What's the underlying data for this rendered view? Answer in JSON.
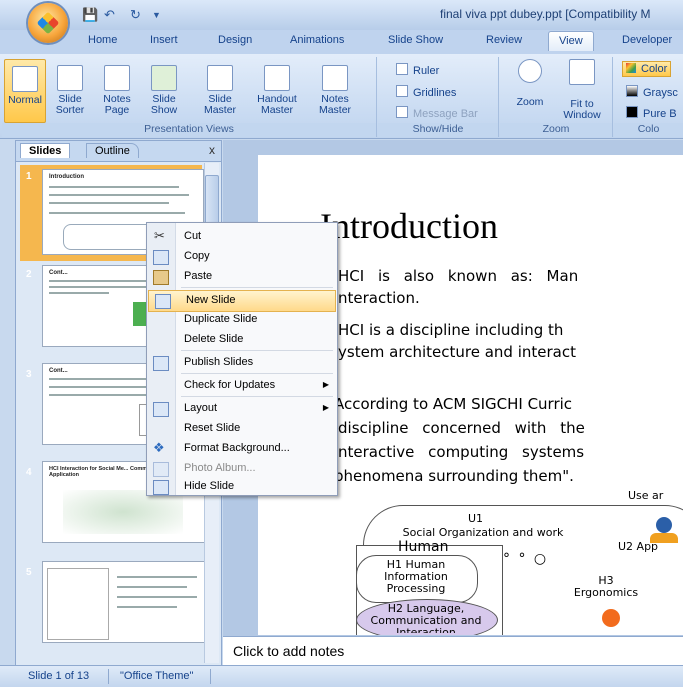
{
  "title_bar": {
    "title": "final viva ppt dubey.ppt [Compatibility M"
  },
  "tabs": [
    "Home",
    "Insert",
    "Design",
    "Animations",
    "Slide Show",
    "Review",
    "View",
    "Developer"
  ],
  "active_tab": "View",
  "ribbon": {
    "presentation_views": {
      "label": "Presentation Views",
      "buttons": [
        {
          "line1": "Normal",
          "line2": ""
        },
        {
          "line1": "Slide",
          "line2": "Sorter"
        },
        {
          "line1": "Notes",
          "line2": "Page"
        },
        {
          "line1": "Slide",
          "line2": "Show"
        },
        {
          "line1": "Slide",
          "line2": "Master"
        },
        {
          "line1": "Handout",
          "line2": "Master"
        },
        {
          "line1": "Notes",
          "line2": "Master"
        }
      ]
    },
    "show_hide": {
      "label": "Show/Hide",
      "items": [
        "Ruler",
        "Gridlines",
        "Message Bar"
      ]
    },
    "zoom": {
      "label": "Zoom",
      "buttons": [
        {
          "line1": "Zoom",
          "line2": ""
        },
        {
          "line1": "Fit to",
          "line2": "Window"
        }
      ]
    },
    "color": {
      "label": "Colo",
      "items": [
        "Color",
        "Graysc",
        "Pure B"
      ]
    }
  },
  "left_pane": {
    "tabs": [
      "Slides",
      "Outline"
    ],
    "close": "x",
    "slides": [
      {
        "num": "1",
        "title": "Introduction"
      },
      {
        "num": "2",
        "title": "Cont..."
      },
      {
        "num": "3",
        "title": "Cont..."
      },
      {
        "num": "4",
        "title": "HCI Interaction for Social Me... Communication & Application"
      },
      {
        "num": "5",
        "title": ""
      }
    ]
  },
  "slide": {
    "title": "Introduction",
    "lines": [
      "HCI is also known as: Man",
      "nteraction.",
      "HCI is a discipline including th",
      "ystem architecture and interact",
      "According to ACM SIGCHI Curric",
      "discipline concerned with the",
      "nteractive computing systems",
      "phenomena surrounding them\"."
    ],
    "diagram": {
      "use_label": "Use ar",
      "u1": "U1",
      "u1_sub": "Social Organization and work",
      "human": "Human",
      "u2": "U2 App",
      "h1": "H1 Human Information Processing",
      "h2": "H2 Language, Communication and Interaction",
      "h3": "H3 Ergonomics"
    }
  },
  "notes_placeholder": "Click to add notes",
  "context_menu": [
    {
      "label": "Cut",
      "icon": "scissors-icon",
      "type": "item"
    },
    {
      "label": "Copy",
      "icon": "copy-icon",
      "type": "item"
    },
    {
      "label": "Paste",
      "icon": "paste-icon",
      "type": "item"
    },
    {
      "type": "sep"
    },
    {
      "label": "New Slide",
      "icon": "new-slide-icon",
      "type": "item",
      "hot": true
    },
    {
      "label": "Duplicate Slide",
      "icon": "",
      "type": "item"
    },
    {
      "label": "Delete Slide",
      "icon": "",
      "type": "item"
    },
    {
      "type": "sep"
    },
    {
      "label": "Publish Slides",
      "icon": "publish-icon",
      "type": "item"
    },
    {
      "type": "sep"
    },
    {
      "label": "Check for Updates",
      "icon": "",
      "type": "item",
      "submenu": true
    },
    {
      "type": "sep"
    },
    {
      "label": "Layout",
      "icon": "layout-icon",
      "type": "item",
      "submenu": true
    },
    {
      "label": "Reset Slide",
      "icon": "",
      "type": "item"
    },
    {
      "label": "Format Background...",
      "icon": "format-background-icon",
      "type": "item"
    },
    {
      "label": "Photo Album...",
      "icon": "photo-album-icon",
      "type": "item",
      "disabled": true
    },
    {
      "label": "Hide Slide",
      "icon": "hide-slide-icon",
      "type": "item"
    }
  ],
  "status_bar": {
    "slide_info": "Slide 1 of 13",
    "theme": "\"Office Theme\""
  }
}
